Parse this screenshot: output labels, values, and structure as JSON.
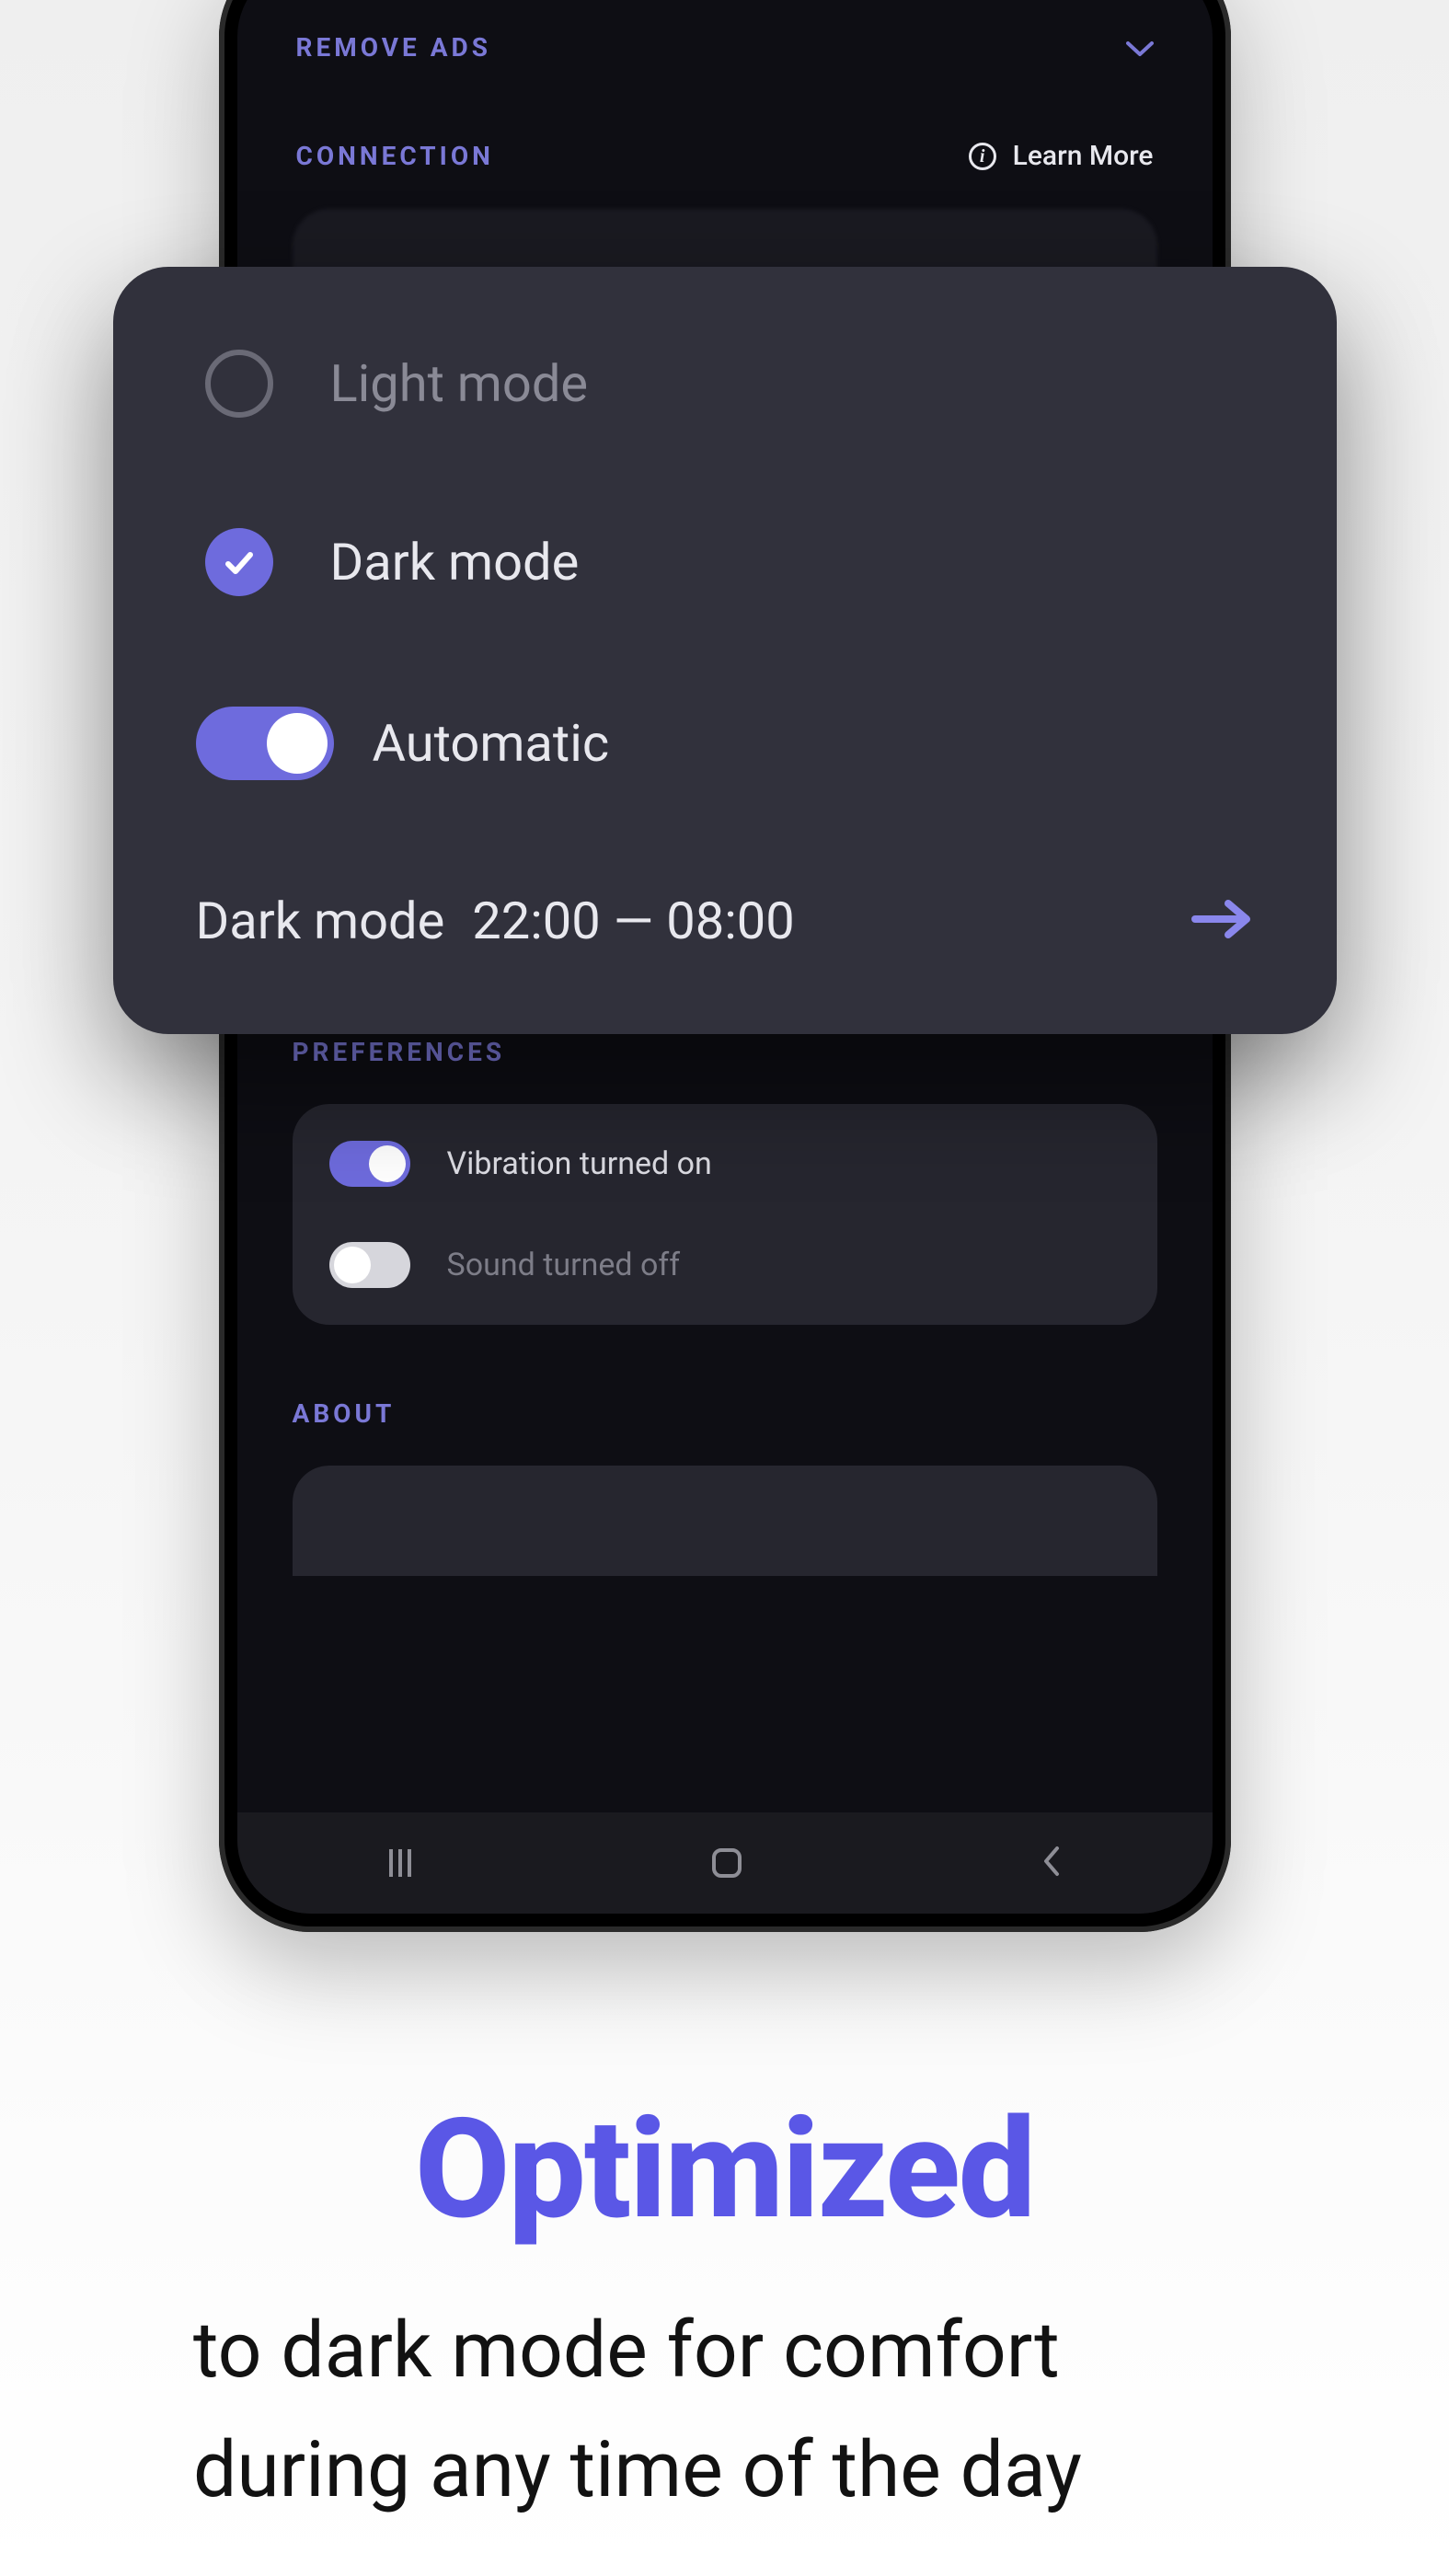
{
  "accent_color": "#6e6bdd",
  "phone_background": {
    "sections": {
      "remove_ads_label": "REMOVE ADS",
      "connection_label": "CONNECTION",
      "learn_more": "Learn More",
      "preferences_label": "PREFERENCES",
      "about_label": "ABOUT"
    },
    "preferences": {
      "vibration": {
        "label": "Vibration turned on",
        "on": true
      },
      "sound": {
        "label": "Sound turned off",
        "on": false
      }
    }
  },
  "theme_card": {
    "options": {
      "light": {
        "label": "Light mode",
        "selected": false
      },
      "dark": {
        "label": "Dark mode",
        "selected": true
      },
      "automatic": {
        "label": "Automatic",
        "on": true
      }
    },
    "schedule": {
      "prefix": "Dark mode",
      "range": "22:00 — 08:00"
    }
  },
  "marketing": {
    "headline": "Optimized",
    "subline": "to dark mode for comfort during any time of the day"
  }
}
